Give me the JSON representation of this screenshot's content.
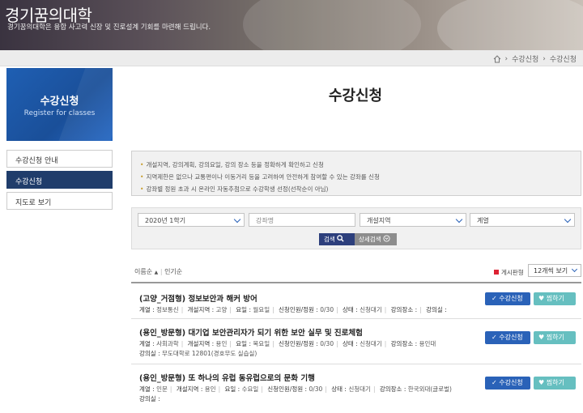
{
  "header": {
    "brand": "경기꿈의대학",
    "tagline": "경기꿈의대학은 융합 사고력 신장 및 진로설계 기회를 마련해 드립니다."
  },
  "breadcrumb": [
    "수강신청",
    "수강신청"
  ],
  "sidebar": {
    "banner_title": "수강신청",
    "banner_subtitle": "Register for classes",
    "items": [
      {
        "label": "수강신청 안내",
        "active": false
      },
      {
        "label": "수강신청",
        "active": true
      },
      {
        "label": "지도로 보기",
        "active": false
      }
    ]
  },
  "main": {
    "title": "수강신청",
    "notices": [
      "개설지역, 강의계획, 강의요일, 강의 장소 등을 정확하게 확인하고 신청",
      "지역제한은 없으나 교통편이나 이동거리 등을 고려하여 안전하게 참여할 수 있는 강좌를 신청",
      "강좌별 정원 초과 시 온라인 자동추첨으로 수강학생 선정(선착순이 아님)"
    ],
    "filters": {
      "semester": "2020년 1학기",
      "course_placeholder": "강좌명",
      "region": "개설지역",
      "category": "계열",
      "search_label": "검색",
      "detail_label": "상세검색"
    },
    "sort": {
      "option1": "이름순",
      "option2": "인기순",
      "view_type": "게시판형",
      "per_page": "12개씩 보기"
    },
    "courses": [
      {
        "title": "(고양_거점형) 정보보안과 해커 방어",
        "series": "정보통신",
        "region": "고양",
        "day": "월요일",
        "enroll": "0/30",
        "status": "신청대기",
        "place": "",
        "room": "",
        "apply": "수강신청",
        "like": "찜하기"
      },
      {
        "title": "(용인_방문형) 대기업 보안관리자가 되기 위한 보안 실무 및 진로체험",
        "series": "사회과학",
        "region": "용인",
        "day": "목요일",
        "enroll": "0/30",
        "status": "신청대기",
        "place": "용인대",
        "room": "무도대학로 12801(경호무도 실습실)",
        "apply": "수강신청",
        "like": "찜하기"
      },
      {
        "title": "(용인_방문형) 또 하나의 유럽 동유럽으로의 문화 기행",
        "series": "인문",
        "region": "용인",
        "day": "수요일",
        "enroll": "0/30",
        "status": "신청대기",
        "place": "한국외대(글로벌)",
        "room": "",
        "apply": "수강신청",
        "like": "찜하기"
      }
    ],
    "labels": {
      "series": "계열 :",
      "region": "개설지역 :",
      "day": "요일 :",
      "enroll": "신청인원/정원 :",
      "status": "상태 :",
      "place": "강의장소 :",
      "room": "강의실 :"
    }
  }
}
